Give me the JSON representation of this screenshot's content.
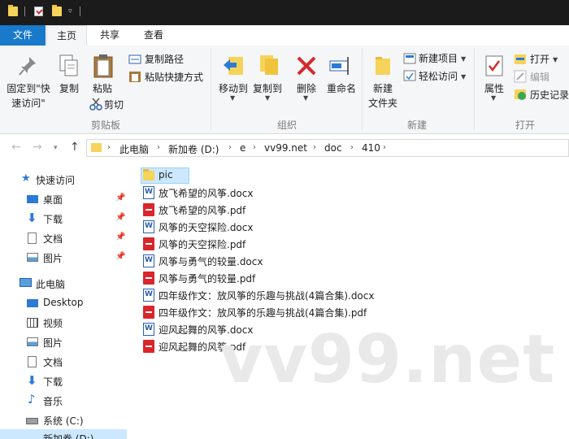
{
  "ribbon_tabs": [
    "文件",
    "主页",
    "共享",
    "查看"
  ],
  "ribbon": {
    "pin_label_1": "固定到\"快",
    "pin_label_2": "速访问\"",
    "copy": "复制",
    "paste": "粘贴",
    "copy_path": "复制路径",
    "paste_shortcut": "粘贴快捷方式",
    "cut": "剪切",
    "group_clipboard": "剪贴板",
    "move_to": "移动到",
    "copy_to": "复制到",
    "delete": "删除",
    "rename": "重命名",
    "group_organize": "组织",
    "new_folder_1": "新建",
    "new_folder_2": "文件夹",
    "new_item": "新建项目",
    "easy_access": "轻松访问",
    "group_new": "新建",
    "properties": "属性",
    "open": "打开",
    "edit": "编辑",
    "history": "历史记录",
    "group_open": "打开"
  },
  "breadcrumb": [
    "此电脑",
    "新加卷 (D:)",
    "e",
    "vv99.net",
    "doc",
    "410"
  ],
  "sidebar": {
    "quick_access": "快速访问",
    "quick_items": [
      "桌面",
      "下载",
      "文档",
      "图片"
    ],
    "this_pc": "此电脑",
    "pc_items": [
      "Desktop",
      "视频",
      "图片",
      "文档",
      "下载",
      "音乐",
      "系统 (C:)",
      "新加卷 (D:)"
    ]
  },
  "files": [
    {
      "name": "pic",
      "type": "folder"
    },
    {
      "name": "放飞希望的风筝.docx",
      "type": "docx"
    },
    {
      "name": "放飞希望的风筝.pdf",
      "type": "pdf"
    },
    {
      "name": "风筝的天空探险.docx",
      "type": "docx"
    },
    {
      "name": "风筝的天空探险.pdf",
      "type": "pdf"
    },
    {
      "name": "风筝与勇气的较量.docx",
      "type": "docx"
    },
    {
      "name": "风筝与勇气的较量.pdf",
      "type": "pdf"
    },
    {
      "name": "四年级作文：放风筝的乐趣与挑战(4篇合集).docx",
      "type": "docx"
    },
    {
      "name": "四年级作文：放风筝的乐趣与挑战(4篇合集).pdf",
      "type": "pdf"
    },
    {
      "name": "迎风起舞的风筝.docx",
      "type": "docx"
    },
    {
      "name": "迎风起舞的风筝.pdf",
      "type": "pdf"
    }
  ],
  "watermark": "vv99.net",
  "colors": {
    "accent": "#1979ca",
    "selection": "#cce8ff",
    "pdf": "#d9262c",
    "folder": "#f6d35a"
  }
}
